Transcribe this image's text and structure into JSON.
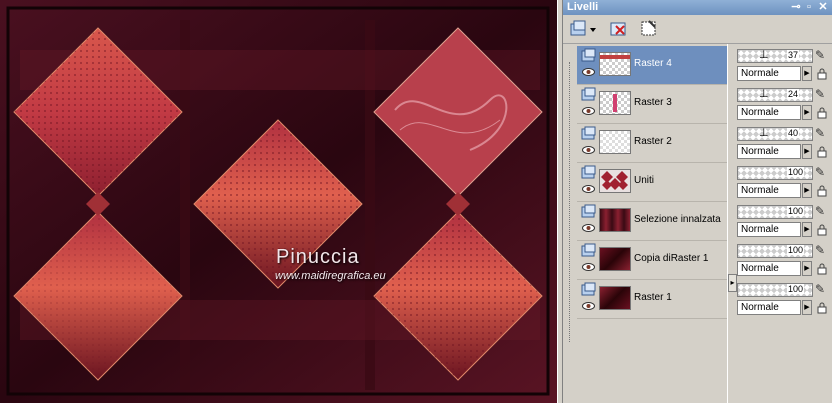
{
  "watermark": {
    "title": "Pinuccia",
    "url": "www.maidiregrafica.eu"
  },
  "panel": {
    "title": "Livelli",
    "controls": [
      "pin-icon",
      "minimize-icon",
      "close-icon"
    ]
  },
  "toolbar": {
    "tools": [
      "new-layer-icon",
      "delete-layer-icon",
      "mask-icon"
    ]
  },
  "layers": [
    {
      "name": "Raster 4",
      "opacity": "37",
      "blend": "Normale",
      "selected": true
    },
    {
      "name": "Raster 3",
      "opacity": "24",
      "blend": "Normale",
      "selected": false
    },
    {
      "name": "Raster 2",
      "opacity": "40",
      "blend": "Normale",
      "selected": false
    },
    {
      "name": "Uniti",
      "opacity": "100",
      "blend": "Normale",
      "selected": false
    },
    {
      "name": "Selezione innalzata",
      "opacity": "100",
      "blend": "Normale",
      "selected": false
    },
    {
      "name": "Copia diRaster 1",
      "opacity": "100",
      "blend": "Normale",
      "selected": false
    },
    {
      "name": "Raster 1",
      "opacity": "100",
      "blend": "Normale",
      "selected": false
    }
  ],
  "colors": {
    "selection": "#6e8fbe",
    "titlebar": "#7a9bc8",
    "canvas_dark": "#2a0810",
    "diamond": "#c2403e"
  }
}
